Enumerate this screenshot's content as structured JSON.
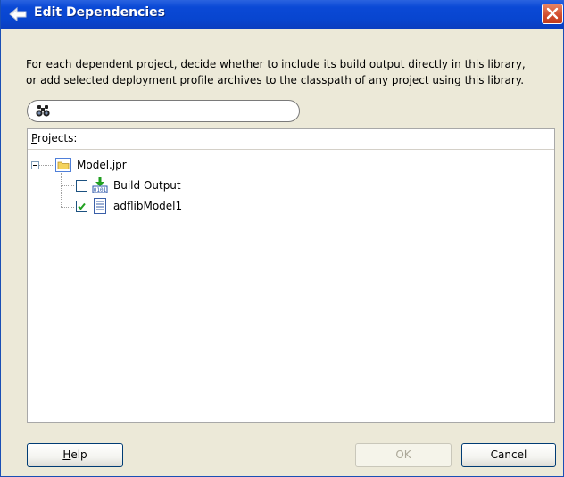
{
  "dialog": {
    "title": "Edit Dependencies",
    "description_line1": "For each dependent project, decide whether to include its build output directly in this library,",
    "description_line2": "or add selected deployment profile archives to the classpath of any project using this library."
  },
  "search": {
    "value": "",
    "placeholder": ""
  },
  "projects": {
    "label_mnemonic": "P",
    "label_rest": "rojects:",
    "tree": {
      "root": {
        "label": "Model.jpr",
        "expanded": true
      },
      "children": [
        {
          "label": "Build Output",
          "checked": false,
          "icon": "build-output-icon"
        },
        {
          "label": "adflibModel1",
          "checked": true,
          "icon": "deployment-profile-icon"
        }
      ]
    }
  },
  "buttons": {
    "help_mnemonic": "H",
    "help_rest": "elp",
    "ok": "OK",
    "ok_enabled": false,
    "cancel": "Cancel"
  },
  "colors": {
    "titlebar": "#0845cf",
    "close": "#d04a2c",
    "window_bg": "#ece9d8",
    "check": "#21a121"
  }
}
